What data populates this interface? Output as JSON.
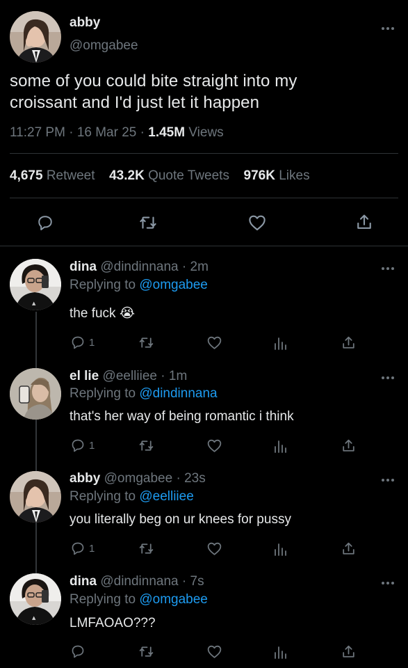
{
  "main_tweet": {
    "display_name": "abby",
    "handle": "@omgabee",
    "text_line1": "some of you could bite straight into my",
    "text_line2": "croissant and I'd just let it happen",
    "time": "11:27 PM",
    "date": "16 Mar 25",
    "sep1": "·",
    "sep2": "·",
    "views_count": "1.45M",
    "views_label": "Views",
    "retweets_count": "4,675",
    "retweets_label": "Retweet",
    "quotes_count": "43.2K",
    "quotes_label": "Quote Tweets",
    "likes_count": "976K",
    "likes_label": "Likes"
  },
  "replies": [
    {
      "display_name": "dina",
      "handle": "@dindinnana",
      "sep": "·",
      "time": "2m",
      "replying_label": "Replying to",
      "replying_to": "@omgabee",
      "text": "the fuck",
      "emoji": "😭",
      "reply_count": "1"
    },
    {
      "display_name": "el lie",
      "handle": "@eelliiee",
      "sep": "·",
      "time": "1m",
      "replying_label": "Replying to",
      "replying_to": "@dindinnana",
      "text": "that's her way of being romantic i think",
      "reply_count": "1"
    },
    {
      "display_name": "abby",
      "handle": "@omgabee",
      "sep": "·",
      "time": "23s",
      "replying_label": "Replying to",
      "replying_to": "@eelliiee",
      "text": "you literally beg on ur knees for pussy",
      "reply_count": "1"
    },
    {
      "display_name": "dina",
      "handle": "@dindinnana",
      "sep": "·",
      "time": "7s",
      "replying_label": "Replying to",
      "replying_to": "@omgabee",
      "text": "LMFAOAO???",
      "reply_count": ""
    }
  ],
  "colors": {
    "background": "#000000",
    "text": "#e7e9ea",
    "muted": "#6e767d",
    "link": "#1d9bf0",
    "divider": "#2f3336"
  },
  "icons": {
    "reply": "reply-icon",
    "retweet": "retweet-icon",
    "like": "heart-icon",
    "analytics": "analytics-icon",
    "share": "share-icon",
    "more": "more-options-icon"
  }
}
